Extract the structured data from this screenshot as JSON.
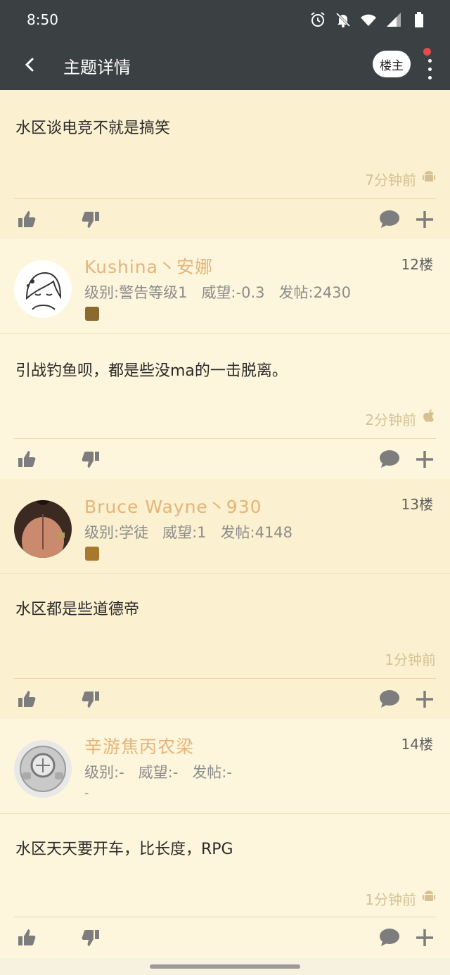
{
  "status_bar": {
    "time": "8:50"
  },
  "app_bar": {
    "title": "主题详情",
    "owner_button": "楼主"
  },
  "posts": [
    {
      "content": "水区谈电竞不就是搞笑",
      "time": "7分钟前",
      "os_icon": "android-icon"
    },
    {
      "user": {
        "name": "Kushina丶安娜",
        "floor": "12楼",
        "level": "级别:警告等级1",
        "prestige": "威望:-0.3",
        "posts": "发帖:2430"
      },
      "content": "引战钓鱼呗，都是些没ma的一击脱离。",
      "time": "2分钟前",
      "os_icon": "apple-icon"
    },
    {
      "user": {
        "name": "Bruce Wayne丶930",
        "floor": "13楼",
        "level": "级别:学徒",
        "prestige": "威望:1",
        "posts": "发帖:4148"
      },
      "content": "水区都是些道德帝",
      "time": "1分钟前",
      "os_icon": ""
    },
    {
      "user": {
        "name": "辛游焦丙农梁",
        "floor": "14楼",
        "level": "级别:-",
        "prestige": "威望:-",
        "posts": "发帖:-",
        "extra": "-"
      },
      "content": "水区天天要开车，比长度，RPG",
      "time": "1分钟前",
      "os_icon": "android-icon"
    }
  ],
  "colors": {
    "header": "#3b4143",
    "username": "#e5b47a",
    "row_light": "#fdf6dc",
    "row_dark": "#fbf0cf"
  }
}
